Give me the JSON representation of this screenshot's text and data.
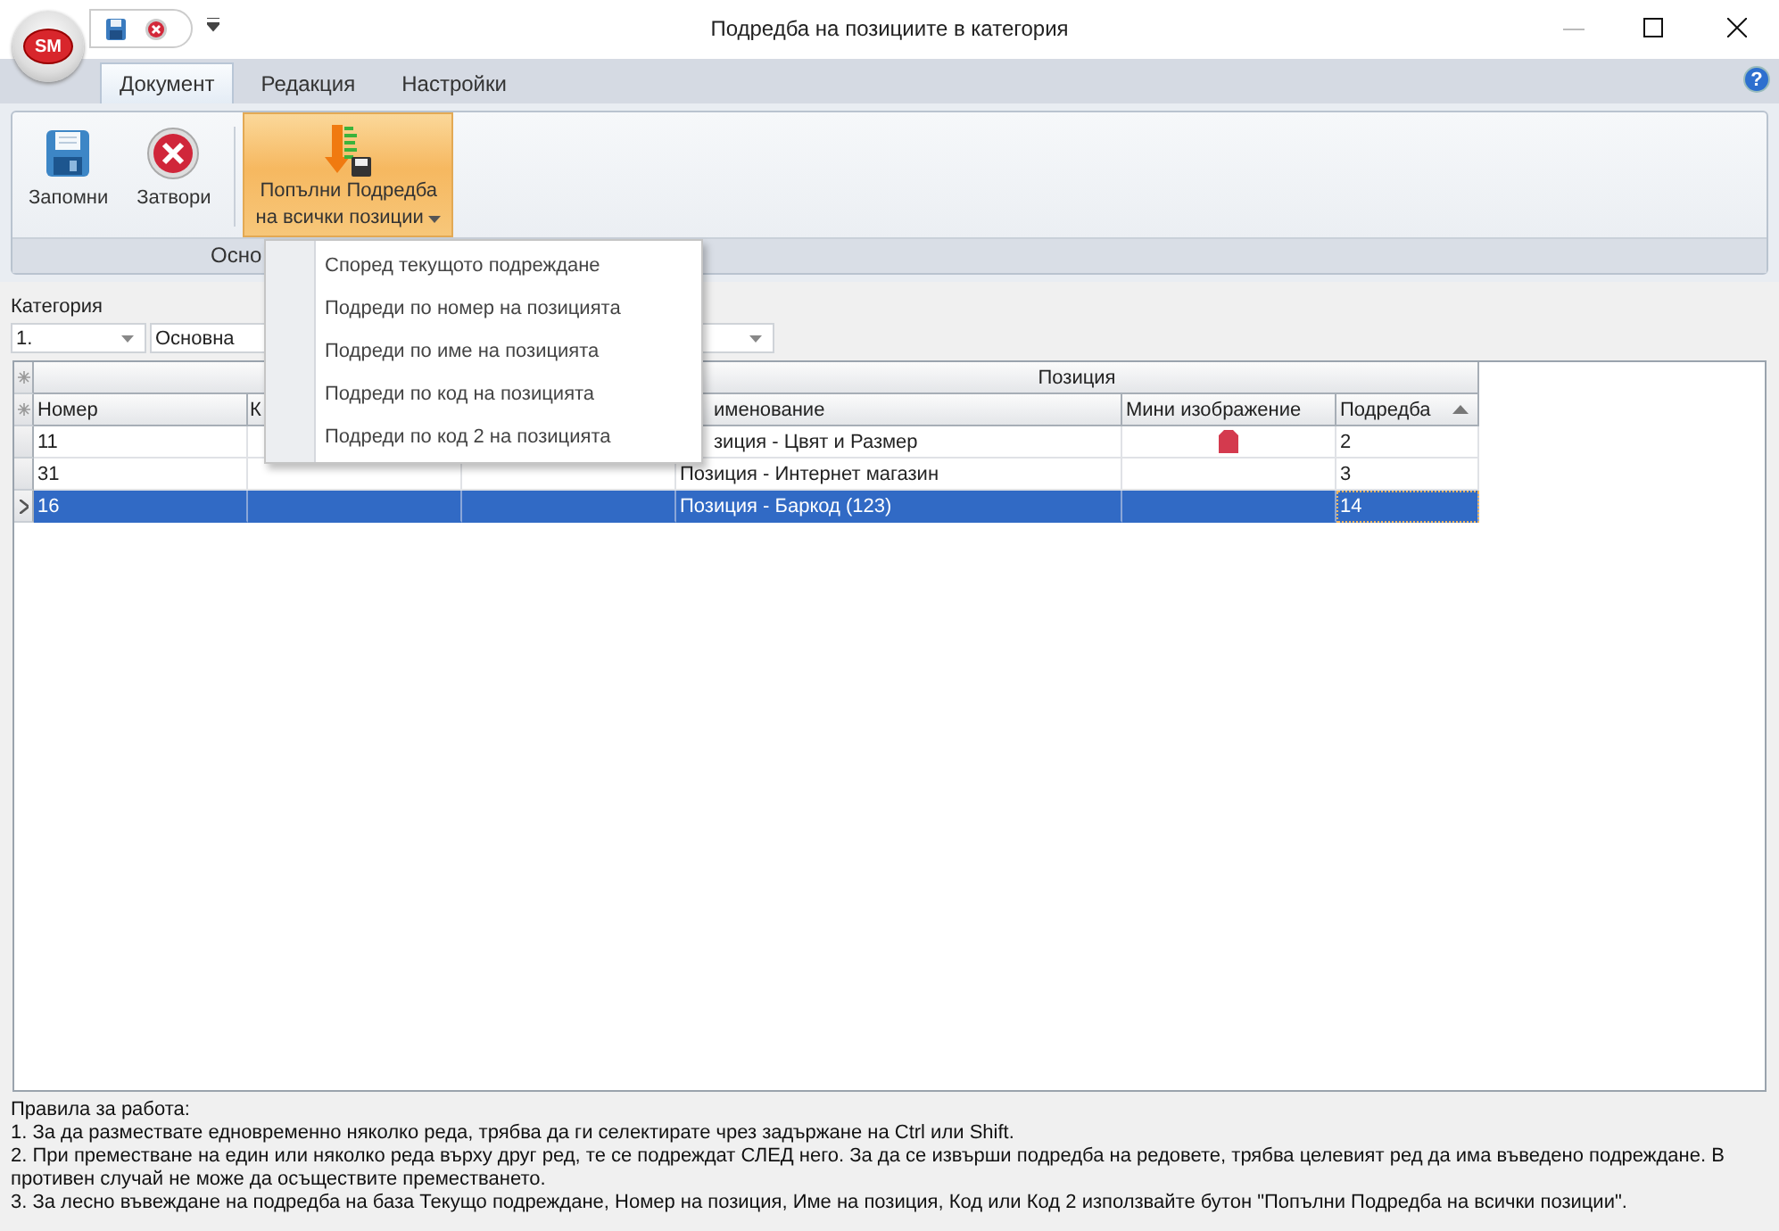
{
  "app_logo": "SM",
  "window": {
    "title": "Подредба на позициите в категория"
  },
  "help": "?",
  "tabs": [
    {
      "label": "Документ",
      "selected": true
    },
    {
      "label": "Редакция",
      "selected": false
    },
    {
      "label": "Настройки",
      "selected": false
    }
  ],
  "ribbon": {
    "buttons": [
      {
        "kind": "save",
        "lines": [
          "Запомни"
        ],
        "active": false,
        "dropdown": false
      },
      {
        "kind": "close",
        "lines": [
          "Затвори"
        ],
        "active": false,
        "dropdown": false
      },
      {
        "kind": "fill",
        "lines": [
          "Попълни Подредба",
          "на всички позиции"
        ],
        "active": true,
        "dropdown": true
      }
    ],
    "group_label": "Осно"
  },
  "menu": {
    "items": [
      "Според текущото подреждане",
      "Подреди по номер на позицията",
      "Подреди по име на позицията",
      "Подреди по код на позицията",
      "Подреди по код 2 на позицията"
    ]
  },
  "category": {
    "label": "Категория",
    "code": "1.",
    "name": "Основна"
  },
  "grid": {
    "band": "Позиция",
    "columns": [
      {
        "label": "Номер",
        "sorted_ascending": false
      },
      {
        "label": "К"
      },
      {},
      {
        "label": "именование",
        "sorted_ascending": false
      },
      {
        "label": "Мини изображение",
        "sorted_ascending": false
      },
      {
        "label": "Подредба",
        "sorted_ascending": true
      }
    ],
    "rows": [
      {
        "number": "11",
        "name": "зиция - Цвят и Размер",
        "thumbnail": true,
        "order": "2",
        "selected": false
      },
      {
        "number": "31",
        "name": "Позиция - Интернет магазин",
        "thumbnail": false,
        "order": "3",
        "selected": false
      },
      {
        "number": "16",
        "name": "Позиция - Баркод (123)",
        "thumbnail": false,
        "order": "14",
        "selected": true
      }
    ]
  },
  "rules": {
    "title": "Правила за работа:",
    "lines": [
      "1. За да размествате едновременно няколко реда, трябва да ги селектирате чрез задържане на Ctrl или Shift.",
      "2. При преместване на един или няколко реда върху друг ред, те се подреждат СЛЕД него. За да се извърши подредба на редовете, трябва целевият ред да има въведено подреждане. В противен случай не може да осъществите преместването.",
      "3. За лесно въвеждане на подредба на база Текущо подреждане, Номер на позиция, Име на позиция, Код или Код 2 използвайте бутон \"Попълни Подредба на всички позиции\"."
    ]
  }
}
